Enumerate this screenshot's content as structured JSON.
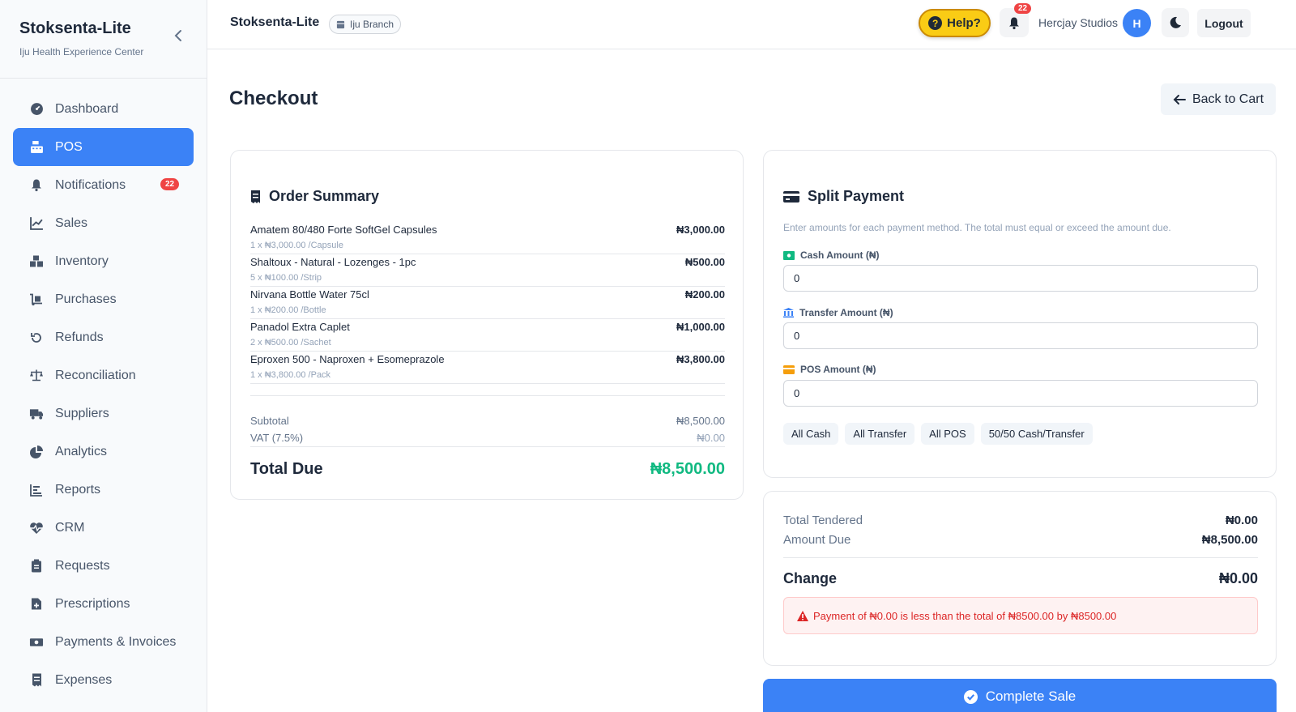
{
  "sidebar": {
    "title": "Stoksenta-Lite",
    "subtitle": "Iju Health Experience Center",
    "items": [
      {
        "label": "Dashboard",
        "icon": "dashboard-icon"
      },
      {
        "label": "POS",
        "icon": "cash-register-icon",
        "active": true
      },
      {
        "label": "Notifications",
        "icon": "bell-icon",
        "badge": "22"
      },
      {
        "label": "Sales",
        "icon": "chart-line-icon"
      },
      {
        "label": "Inventory",
        "icon": "boxes-icon"
      },
      {
        "label": "Purchases",
        "icon": "dolly-icon"
      },
      {
        "label": "Refunds",
        "icon": "undo-icon"
      },
      {
        "label": "Reconciliation",
        "icon": "balance-scale-icon"
      },
      {
        "label": "Suppliers",
        "icon": "truck-icon"
      },
      {
        "label": "Analytics",
        "icon": "pie-chart-icon"
      },
      {
        "label": "Reports",
        "icon": "bar-chart-icon"
      },
      {
        "label": "CRM",
        "icon": "heartbeat-icon"
      },
      {
        "label": "Requests",
        "icon": "clipboard-icon"
      },
      {
        "label": "Prescriptions",
        "icon": "file-medical-icon"
      },
      {
        "label": "Payments & Invoices",
        "icon": "money-icon"
      },
      {
        "label": "Expenses",
        "icon": "receipt-icon"
      }
    ]
  },
  "header": {
    "title": "Stoksenta-Lite",
    "branch": "Iju Branch",
    "help_label": "Help?",
    "notification_count": "22",
    "user_name": "Hercjay Studios",
    "avatar_initial": "H",
    "logout_label": "Logout"
  },
  "page": {
    "title": "Checkout",
    "back_label": "Back to Cart"
  },
  "order_summary": {
    "title": "Order Summary",
    "items": [
      {
        "name": "Amatem 80/480 Forte SoftGel Capsules",
        "detail": "1 x ₦3,000.00 /Capsule",
        "amount": "₦3,000.00"
      },
      {
        "name": "Shaltoux - Natural - Lozenges - 1pc",
        "detail": "5 x ₦100.00 /Strip",
        "amount": "₦500.00"
      },
      {
        "name": "Nirvana Bottle Water 75cl",
        "detail": "1 x ₦200.00 /Bottle",
        "amount": "₦200.00"
      },
      {
        "name": "Panadol Extra Caplet",
        "detail": "2 x ₦500.00 /Sachet",
        "amount": "₦1,000.00"
      },
      {
        "name": "Eproxen 500 - Naproxen + Esomeprazole",
        "detail": "1 x ₦3,800.00 /Pack",
        "amount": "₦3,800.00"
      }
    ],
    "subtotal_label": "Subtotal",
    "subtotal": "₦8,500.00",
    "vat_label": "VAT (7.5%)",
    "vat": "₦0.00",
    "total_label": "Total Due",
    "total": "₦8,500.00"
  },
  "split_payment": {
    "title": "Split Payment",
    "description": "Enter amounts for each payment method. The total must equal or exceed the amount due.",
    "cash_label": "Cash Amount (₦)",
    "cash_value": "0",
    "transfer_label": "Transfer Amount (₦)",
    "transfer_value": "0",
    "pos_label": "POS Amount (₦)",
    "pos_value": "0",
    "quick_buttons": [
      "All Cash",
      "All Transfer",
      "All POS",
      "50/50 Cash/Transfer"
    ]
  },
  "totals": {
    "tendered_label": "Total Tendered",
    "tendered": "₦0.00",
    "due_label": "Amount Due",
    "due": "₦8,500.00",
    "change_label": "Change",
    "change": "₦0.00",
    "alert": "Payment of ₦0.00 is less than the total of ₦8500.00 by ₦8500.00"
  },
  "complete_label": "Complete Sale",
  "colors": {
    "primary": "#3b82f6",
    "success": "#10b981",
    "danger": "#dc2626",
    "help": "#facc15"
  }
}
